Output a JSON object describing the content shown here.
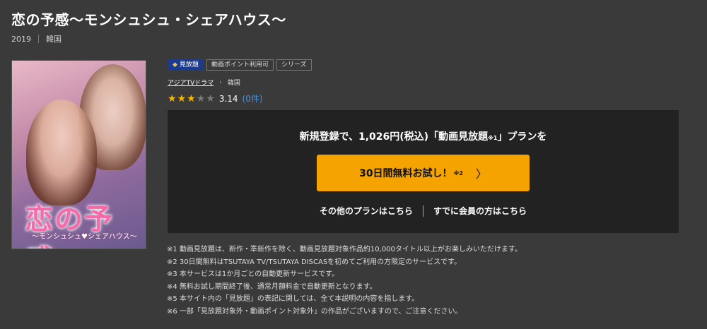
{
  "title": "恋の予感〜モンシュシュ・シェアハウス〜",
  "meta": {
    "year": "2019",
    "country": "韓国"
  },
  "poster": {
    "logo": "恋の予感",
    "subtitle": "〜モンシュシュ♥シェアハウス〜"
  },
  "badges": {
    "unlimited": "見放題",
    "points": "動画ポイント利用可",
    "series": "シリーズ",
    "diamond_icon": "diamond-icon"
  },
  "breadcrumbs": {
    "genre": "アジアTVドラマ",
    "country": "韓国"
  },
  "rating": {
    "score": "3.14",
    "count": "(0件)",
    "stars_filled": 3,
    "stars_total": 5
  },
  "panel": {
    "headline_main": "新規登録で、1,026円(税込)「動画見放題",
    "headline_note": "※1",
    "headline_end": "」プランを",
    "trial_label": "30日間無料お試し！",
    "trial_note": "※2",
    "other_plans": "その他のプランはこちら",
    "member_login": "すでに会員の方はこちら"
  },
  "notes": [
    "※1 動画見放題は、新作・準新作を除く、動画見放題対象作品約10,000タイトル以上がお楽しみいただけます。",
    "※2 30日間無料はTSUTAYA TV/TSUTAYA DISCASを初めてご利用の方限定のサービスです。",
    "※3 本サービスは1か月ごとの自動更新サービスです。",
    "※4 無料お試し期間終了後、通常月額料金で自動更新となります。",
    "※5 本サイト内の「見放題」の表記に関しては、全て本説明の内容を指します。",
    "※6 一部「見放題対象外・動画ポイント対象外」の作品がございますので、ご注意ください。"
  ],
  "colors": {
    "accent": "#f5a300",
    "badge_blue": "#1c3b8c",
    "star": "#f6b700",
    "link": "#4a90e2"
  }
}
